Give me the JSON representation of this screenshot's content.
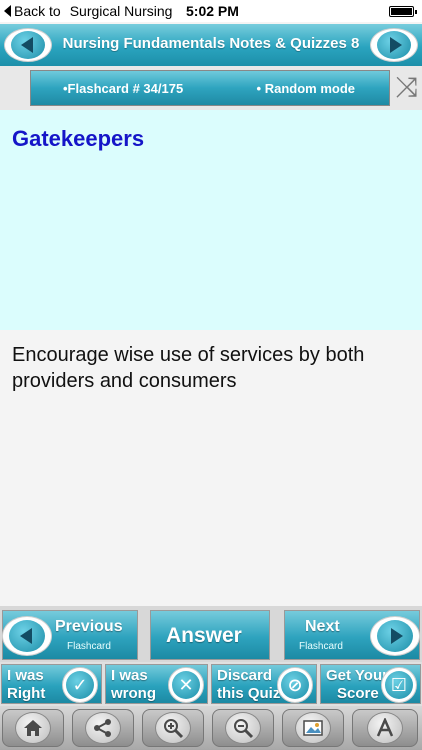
{
  "status_bar": {
    "back_label": "Back to",
    "back_app": "Surgical Nursing",
    "time": "5:02 PM"
  },
  "header": {
    "title": "Nursing Fundamentals Notes & Quizzes 8"
  },
  "info_bar": {
    "flashcard_label": "•Flashcard #  34/175",
    "mode_label": "• Random mode"
  },
  "question": {
    "text": "Gatekeepers"
  },
  "answer": {
    "text": "Encourage wise use of services by both providers and consumers"
  },
  "nav": {
    "previous_label": "Previous",
    "previous_sub": "Flashcard",
    "answer_label": "Answer",
    "next_label": "Next",
    "next_sub": "Flashcard"
  },
  "actions": {
    "right_l1": "I was",
    "right_l2": "Right",
    "wrong_l1": "I was",
    "wrong_l2": "wrong",
    "discard_l1": "Discard",
    "discard_l2": "this Quiz",
    "score_l1": "Get Your",
    "score_l2": "Score"
  },
  "toolbar": {
    "icons": [
      "home-icon",
      "share-icon",
      "zoom-in-icon",
      "zoom-out-icon",
      "image-icon",
      "font-icon"
    ]
  },
  "colors": {
    "accent": "#2aa4bf",
    "question_bg": "#dbfdfd",
    "question_text": "#1515c8"
  }
}
